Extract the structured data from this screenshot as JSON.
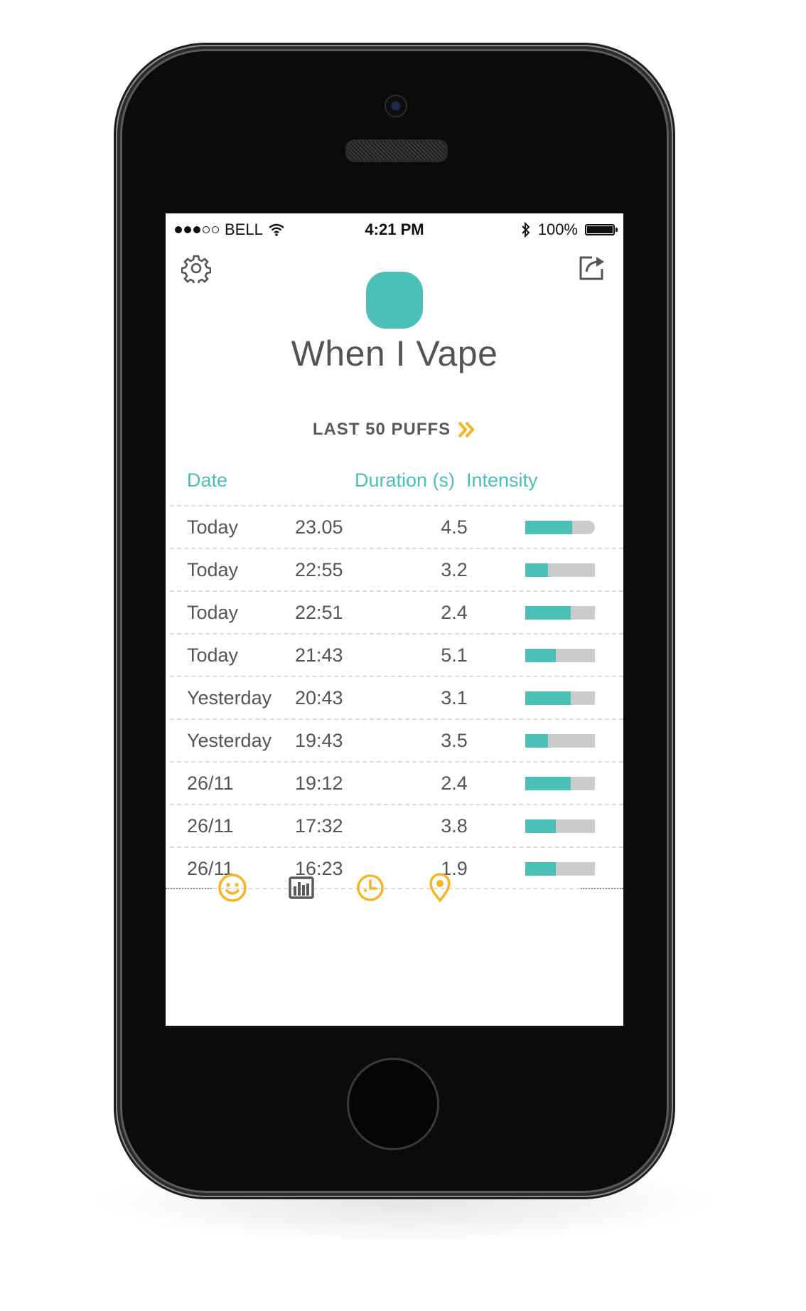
{
  "status_bar": {
    "carrier": "BELL",
    "time": "4:21 PM",
    "battery": "100%"
  },
  "header": {
    "title": "When I Vape",
    "filter_label": "LAST 50 PUFFS"
  },
  "table": {
    "headers": {
      "date": "Date",
      "duration": "Duration (s)",
      "intensity": "Intensity"
    },
    "rows": [
      {
        "day": "Today",
        "time": "23.05",
        "duration": "4.5",
        "intensity": 0.67
      },
      {
        "day": "Today",
        "time": "22:55",
        "duration": "3.2",
        "intensity": 0.33
      },
      {
        "day": "Today",
        "time": "22:51",
        "duration": "2.4",
        "intensity": 0.65
      },
      {
        "day": "Today",
        "time": "21:43",
        "duration": "5.1",
        "intensity": 0.44
      },
      {
        "day": "Yesterday",
        "time": "20:43",
        "duration": "3.1",
        "intensity": 0.65
      },
      {
        "day": "Yesterday",
        "time": "19:43",
        "duration": "3.5",
        "intensity": 0.33
      },
      {
        "day": "26/11",
        "time": "19:12",
        "duration": "2.4",
        "intensity": 0.65
      },
      {
        "day": "26/11",
        "time": "17:32",
        "duration": "3.8",
        "intensity": 0.44
      },
      {
        "day": "26/11",
        "time": "16:23",
        "duration": "1.9",
        "intensity": 0.44
      }
    ]
  },
  "bottom_nav": [
    {
      "icon": "smiley-icon",
      "color": "#f3b524"
    },
    {
      "icon": "bar-chart-icon",
      "color": "#5a5a5a"
    },
    {
      "icon": "clock-icon",
      "color": "#f3b524"
    },
    {
      "icon": "location-pin-icon",
      "color": "#f3b524"
    }
  ],
  "colors": {
    "accent": "#4ac0b7",
    "highlight": "#f3b524",
    "bar_track": "#cccccc",
    "text": "#555555"
  }
}
